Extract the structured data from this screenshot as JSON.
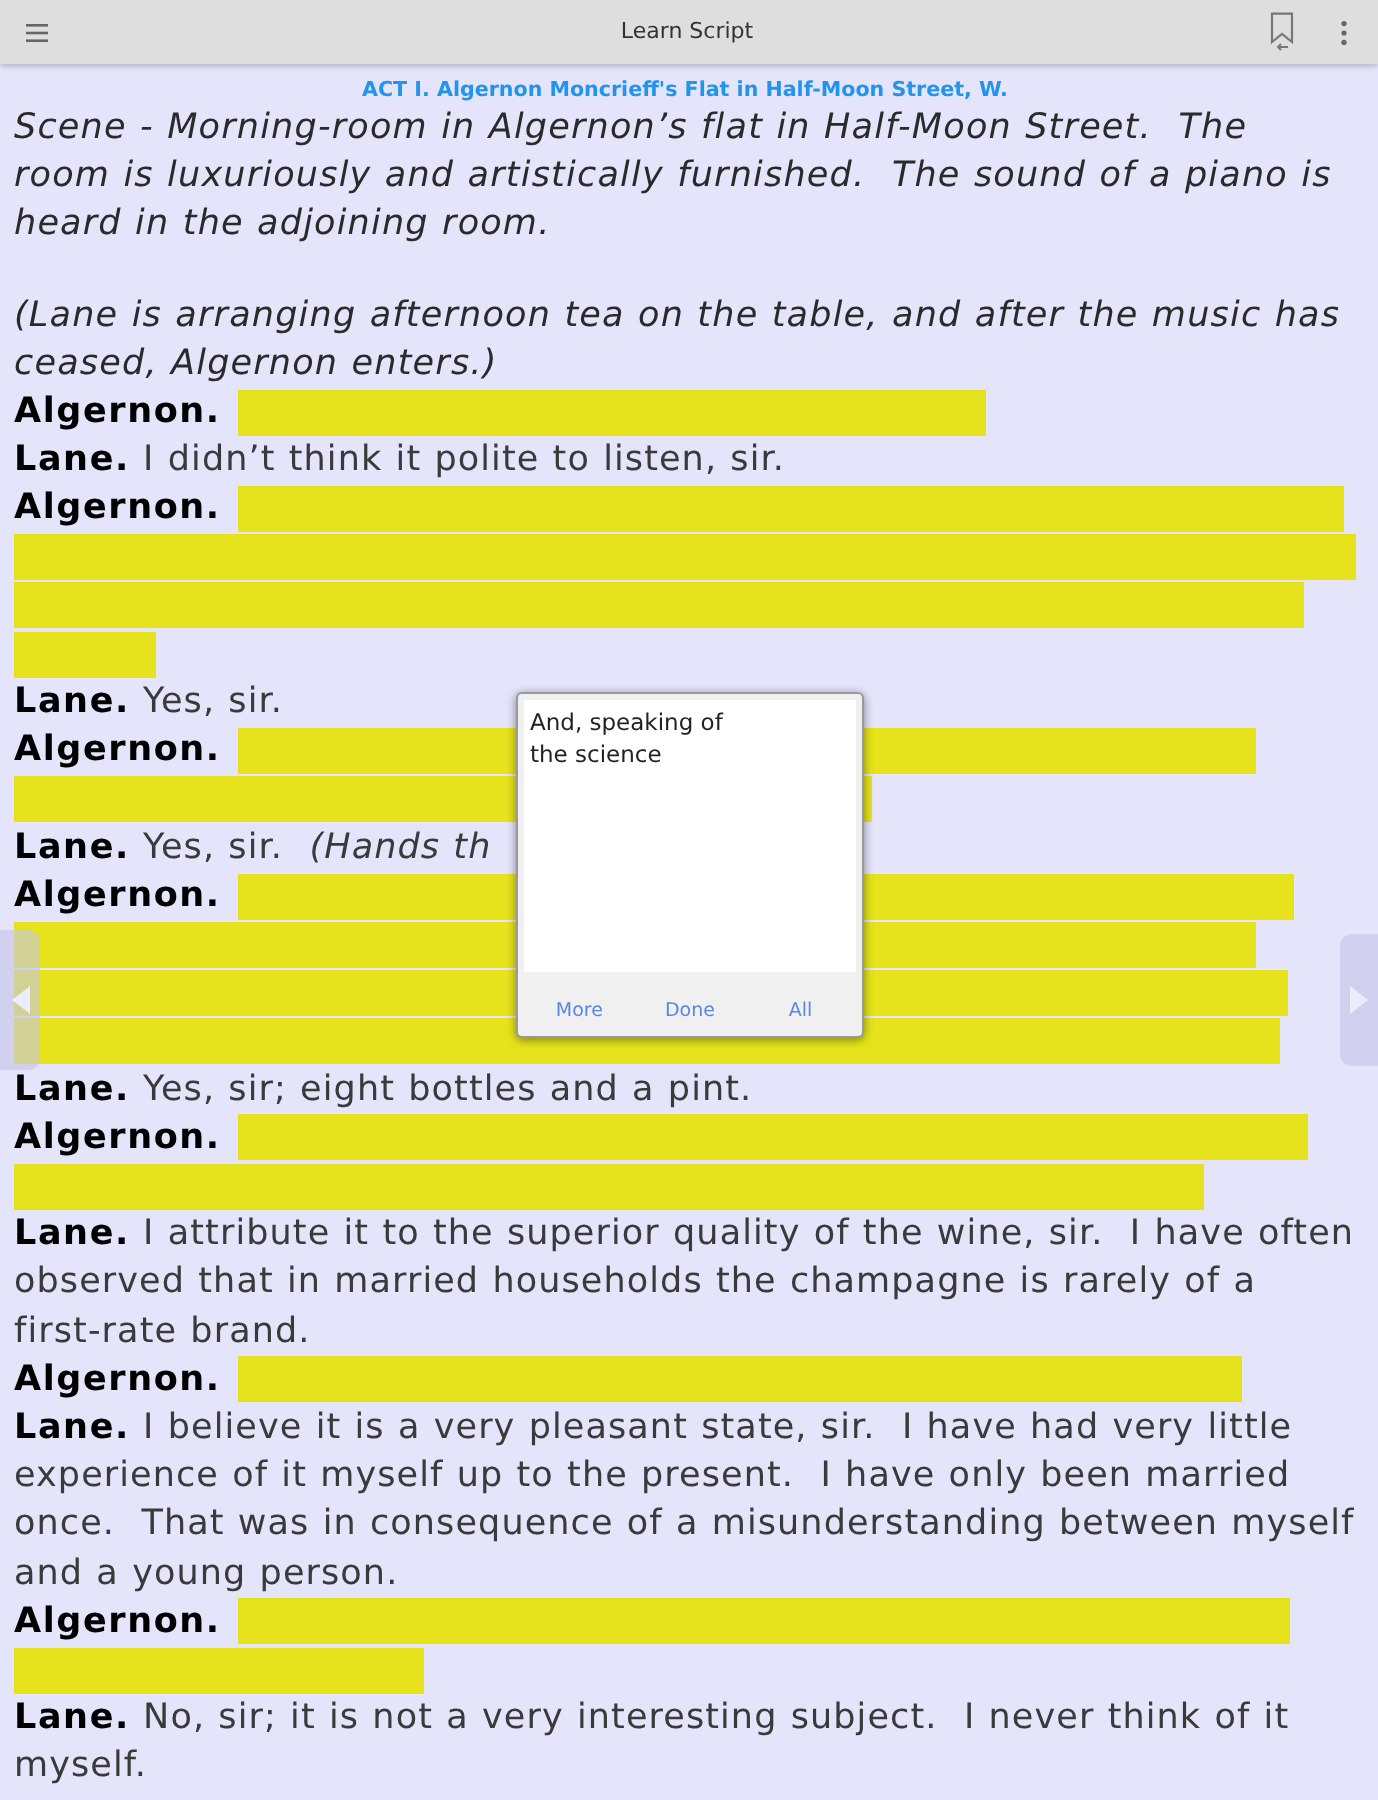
{
  "app_bar": {
    "title": "Learn Script"
  },
  "act_heading": "ACT I. Algernon Moncrieff's Flat in Half-Moon Street, W.",
  "script": [
    {
      "kind": "direction",
      "text": "Scene - Morning-room in Algernon’s flat in Half-Moon Street.  The room is luxuriously and artistically furnished.  The sound of a piano is heard in the adjoining room."
    },
    {
      "kind": "direction",
      "text": "(Lane is arranging afternoon tea on the table, and after the music has ceased, Algernon enters.)"
    },
    {
      "kind": "cue",
      "speaker": "Algernon.",
      "hidden": true
    },
    {
      "kind": "cue",
      "speaker": "Lane.",
      "hidden": false,
      "text": "I didn’t think it polite to listen, sir."
    },
    {
      "kind": "cue",
      "speaker": "Algernon.",
      "hidden": true
    },
    {
      "kind": "cue",
      "speaker": "Lane.",
      "hidden": false,
      "text": "Yes, sir."
    },
    {
      "kind": "cue",
      "speaker": "Algernon.",
      "hidden": true
    },
    {
      "kind": "cue",
      "speaker": "Lane.",
      "hidden": false,
      "text": "Yes, sir.  *(Hands th*"
    },
    {
      "kind": "cue",
      "speaker": "Algernon.",
      "hidden": true
    },
    {
      "kind": "cue",
      "speaker": "Lane.",
      "hidden": false,
      "text": "Yes, sir; eight bottles and a pint."
    },
    {
      "kind": "cue",
      "speaker": "Algernon.",
      "hidden": true
    },
    {
      "kind": "cue",
      "speaker": "Lane.",
      "hidden": false,
      "text": "I attribute it to the superior quality of the wine, sir.  I have often observed that in married households the champagne is rarely of a first-rate brand."
    },
    {
      "kind": "cue",
      "speaker": "Algernon.",
      "hidden": true
    },
    {
      "kind": "cue",
      "speaker": "Lane.",
      "hidden": false,
      "text": "I believe it is a very pleasant state, sir.  I have had very little experience of it myself up to the present.  I have only been married once.  That was in consequence of a misunderstanding between myself and a young person."
    },
    {
      "kind": "cue",
      "speaker": "Algernon.",
      "hidden": true
    },
    {
      "kind": "cue",
      "speaker": "Lane.",
      "hidden": false,
      "text": "No, sir; it is not a very interesting subject.  I never think of it myself."
    }
  ],
  "popup": {
    "value": "And, speaking of the science",
    "buttons": [
      {
        "label": "More"
      },
      {
        "label": "Done"
      },
      {
        "label": "All"
      }
    ]
  }
}
